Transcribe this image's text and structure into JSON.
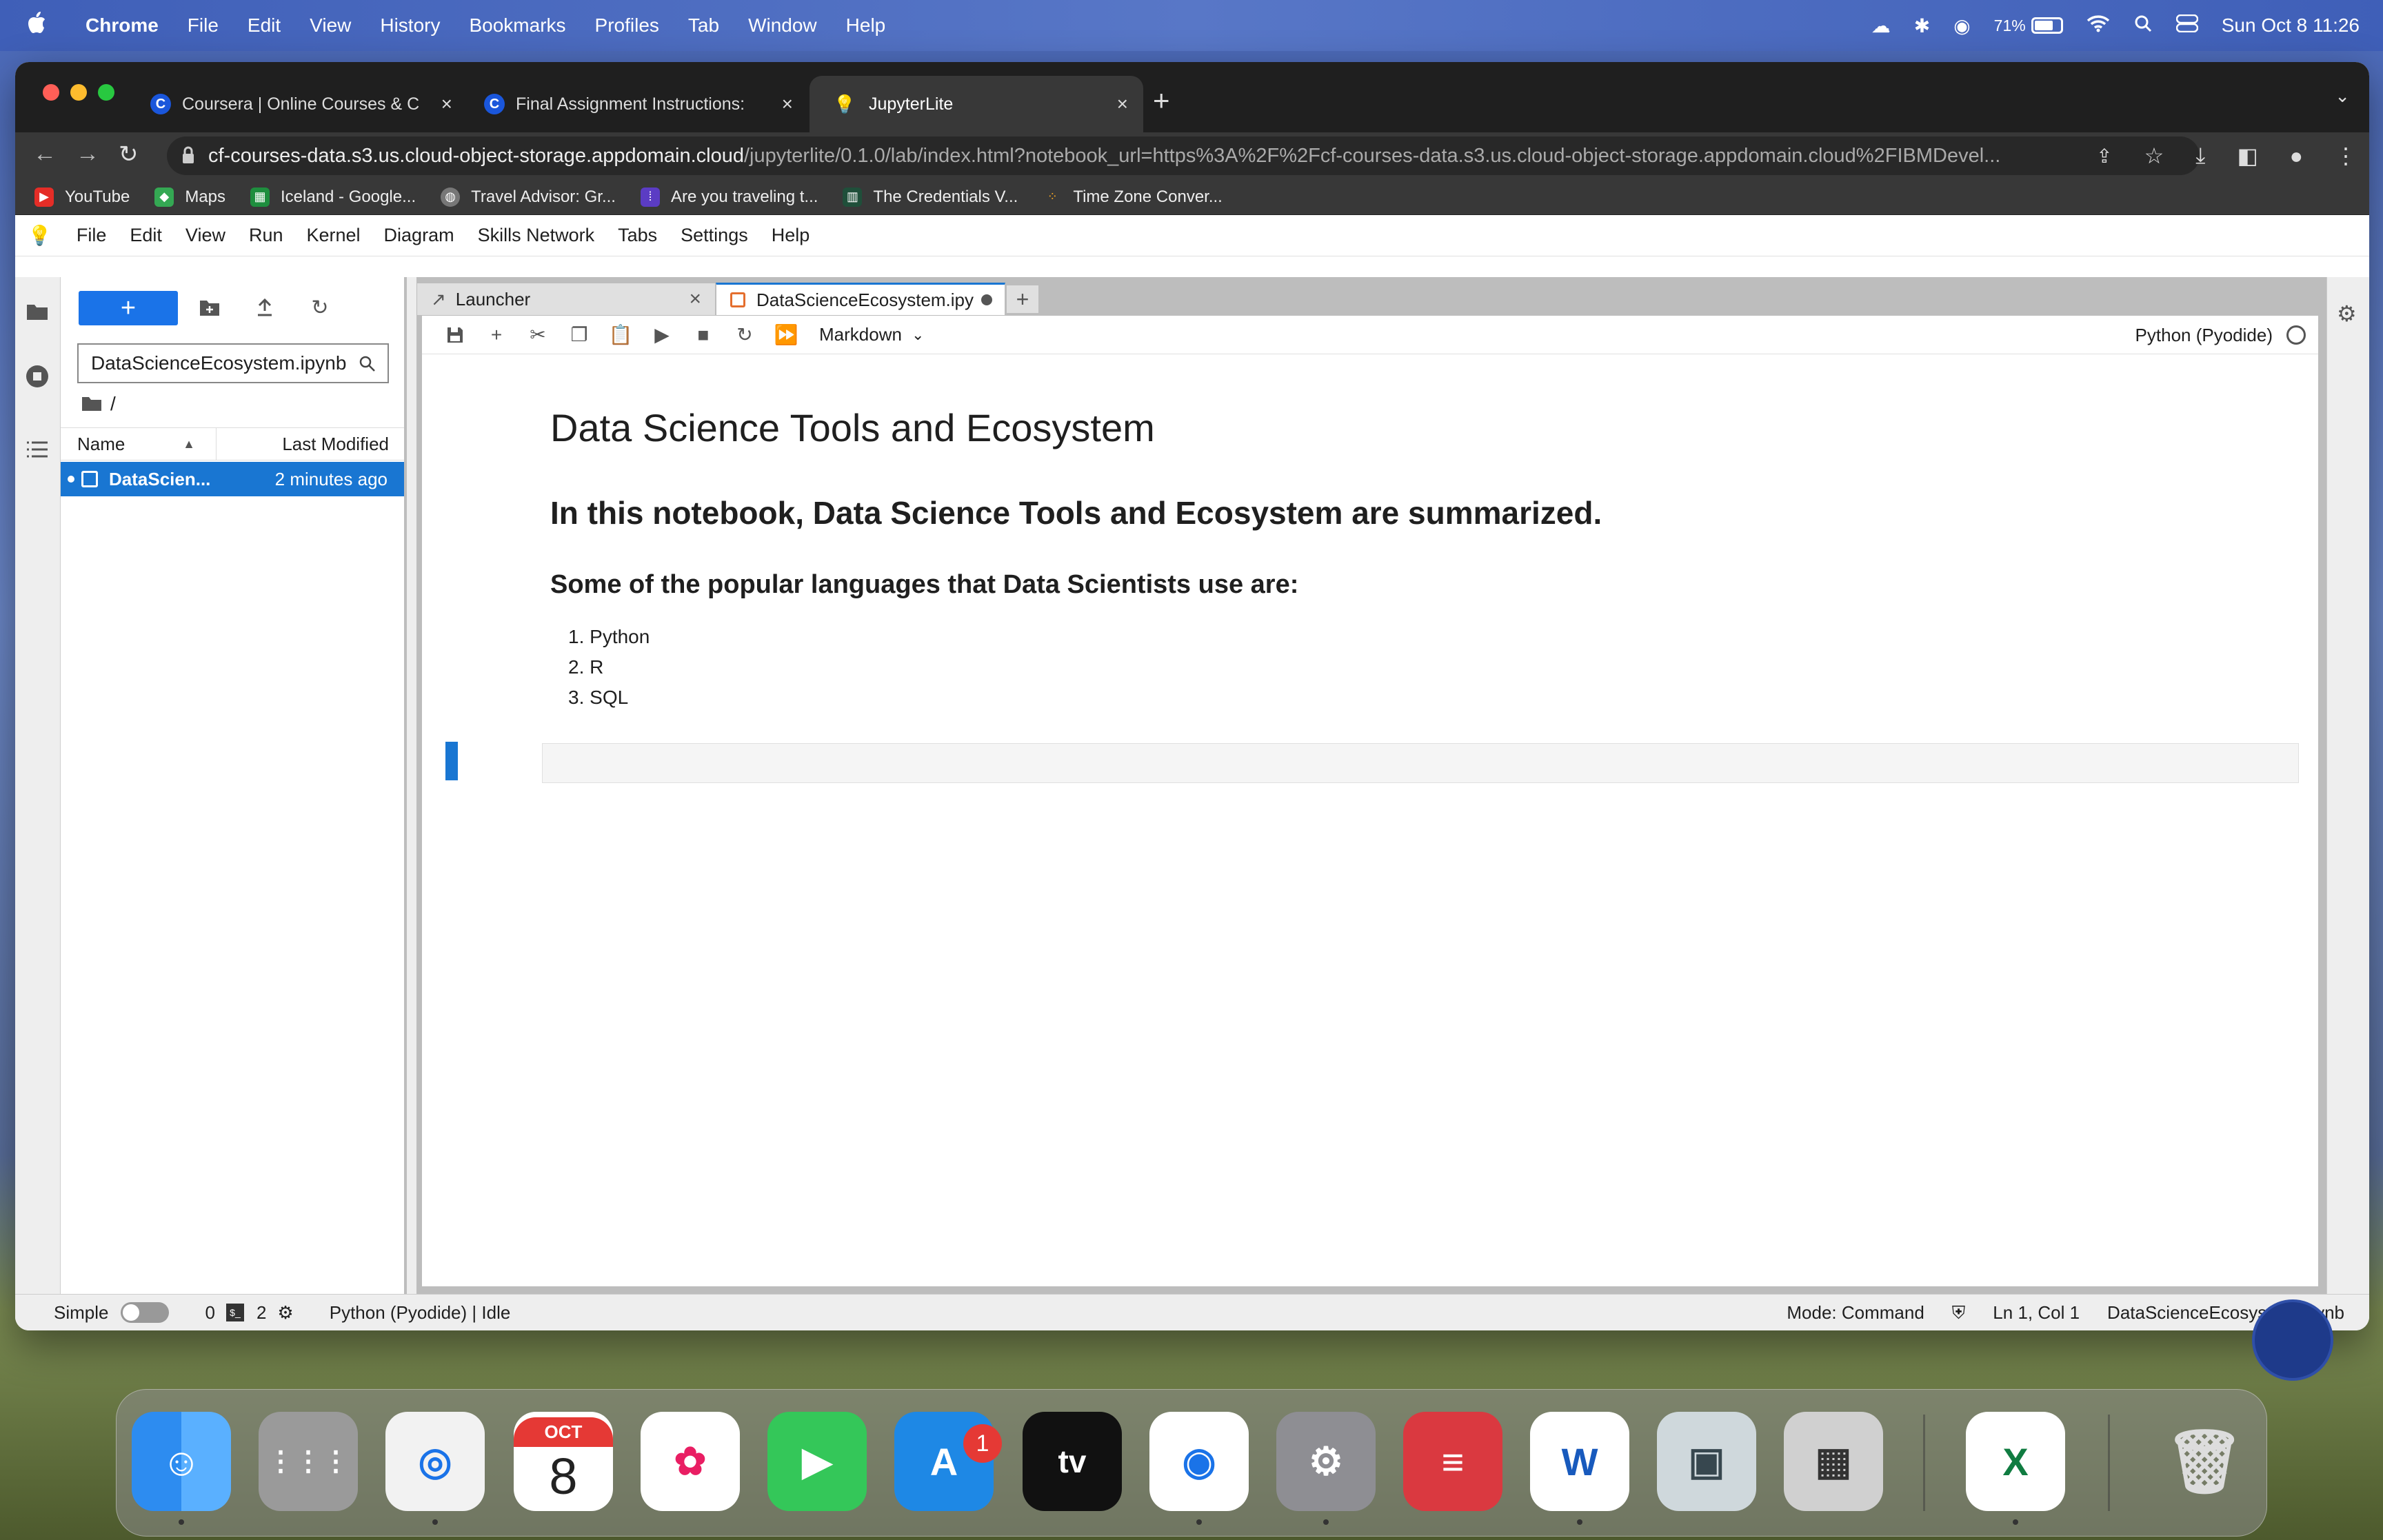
{
  "mac_menu": {
    "app_name": "Chrome",
    "items": [
      "File",
      "Edit",
      "View",
      "History",
      "Bookmarks",
      "Profiles",
      "Tab",
      "Window",
      "Help"
    ],
    "battery_percent": "71%",
    "battery_level": 0.71,
    "datetime": "Sun Oct 8  11:26"
  },
  "browser": {
    "tabs": [
      {
        "title": "Coursera | Online Courses & C",
        "icon": "coursera-icon"
      },
      {
        "title": "Final Assignment Instructions:",
        "icon": "coursera-icon"
      },
      {
        "title": "JupyterLite",
        "icon": "jupyterlite-icon",
        "active": true
      }
    ],
    "url_host": "cf-courses-data.s3.us.cloud-object-storage.appdomain.cloud",
    "url_path": "/jupyterlite/0.1.0/lab/index.html?notebook_url=https%3A%2F%2Fcf-courses-data.s3.us.cloud-object-storage.appdomain.cloud%2FIBMDevel...",
    "bookmarks": [
      "YouTube",
      "Maps",
      "Iceland - Google...",
      "Travel Advisor: Gr...",
      "Are you traveling t...",
      "The Credentials V...",
      "Time Zone Conver..."
    ]
  },
  "jupyter": {
    "menu": [
      "File",
      "Edit",
      "View",
      "Run",
      "Kernel",
      "Diagram",
      "Skills Network",
      "Tabs",
      "Settings",
      "Help"
    ],
    "filebrowser": {
      "search_value": "DataScienceEcosystem.ipynb",
      "breadcrumb": "/",
      "col_name": "Name",
      "col_modified": "Last Modified",
      "files": [
        {
          "name": "DataScien...",
          "modified": "2 minutes ago"
        }
      ]
    },
    "dock_tabs": [
      "Launcher",
      "DataScienceEcosystem.ipy"
    ],
    "cell_type": "Markdown",
    "kernel_name": "Python (Pyodide)",
    "notebook": {
      "h1": "Data Science Tools and Ecosystem",
      "h2": "In this notebook, Data Science Tools and Ecosystem are summarized.",
      "h3": "Some of the popular languages that Data Scientists use are:",
      "languages": [
        "Python",
        "R",
        "SQL"
      ]
    },
    "status": {
      "mode_label": "Simple",
      "terminals": "0",
      "kernels": "2",
      "kernel_status": "Python (Pyodide) | Idle",
      "mode": "Mode: Command",
      "cursor": "Ln 1, Col 1",
      "filename": "DataScienceEcosystem.ipynb"
    }
  },
  "dock": {
    "calendar_month": "OCT",
    "calendar_day": "8",
    "appstore_badge": "1",
    "apps": [
      "finder",
      "launchpad",
      "safari",
      "calendar",
      "photos",
      "facetime",
      "app-store",
      "apple-tv",
      "chrome",
      "system-settings",
      "expressvpn",
      "word",
      "preview",
      "calculator",
      "excel",
      "trash"
    ]
  }
}
